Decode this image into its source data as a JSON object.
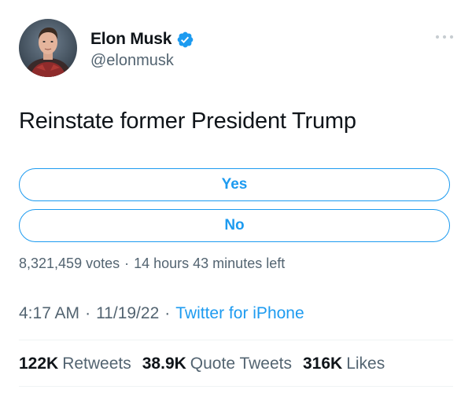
{
  "author": {
    "display_name": "Elon Musk",
    "handle": "@elonmusk",
    "verified": true,
    "avatar_icon": "profile-photo"
  },
  "tweet": {
    "text": "Reinstate former President Trump"
  },
  "poll": {
    "options": [
      {
        "label": "Yes"
      },
      {
        "label": "No"
      }
    ],
    "votes": "8,321,459 votes",
    "separator": "·",
    "time_left": "14 hours 43 minutes left"
  },
  "meta": {
    "time": "4:17 AM",
    "separator": "·",
    "date": "11/19/22",
    "source": "Twitter for iPhone"
  },
  "stats": {
    "retweets_count": "122K",
    "retweets_label": "Retweets",
    "quotes_count": "38.9K",
    "quotes_label": "Quote Tweets",
    "likes_count": "316K",
    "likes_label": "Likes"
  },
  "colors": {
    "accent": "#1d9bf0",
    "text_primary": "#0f1419",
    "text_secondary": "#536471",
    "divider": "#eff3f4"
  }
}
